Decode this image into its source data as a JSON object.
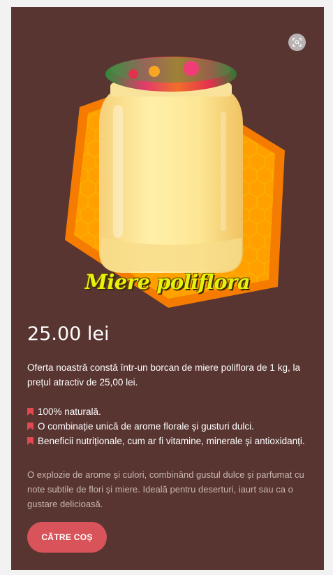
{
  "product": {
    "image_caption": "Miere poliflora",
    "price": "25.00 lei",
    "description": "Oferta noastră constă într-un borcan de miere poliflora de 1 kg, la prețul atractiv de 25,00 lei.",
    "features": [
      {
        "icon": "bookmark-icon",
        "text": "100% naturală."
      },
      {
        "icon": "bookmark-icon",
        "text": "O combinație unică de arome florale și gusturi dulci."
      },
      {
        "icon": "bookmark-icon",
        "text": "Beneficii nutriționale, cum ar fi vitamine, minerale și antioxidanți."
      }
    ],
    "note": "O explozie de arome și culori, combinând gustul dulce și parfumat cu note subtile de flori și miere. Ideală pentru deserturi, iaurt sau ca o gustare delicioasă.",
    "cart_button_label": "CĂTRE COȘ"
  },
  "icons": {
    "zoom": "zoom-icon",
    "feature_bullet": "bookmark-icon"
  },
  "colors": {
    "card_background": "#583531",
    "button": "#d9545a",
    "bullet": "#e2484f",
    "caption": "#e7f20c"
  }
}
